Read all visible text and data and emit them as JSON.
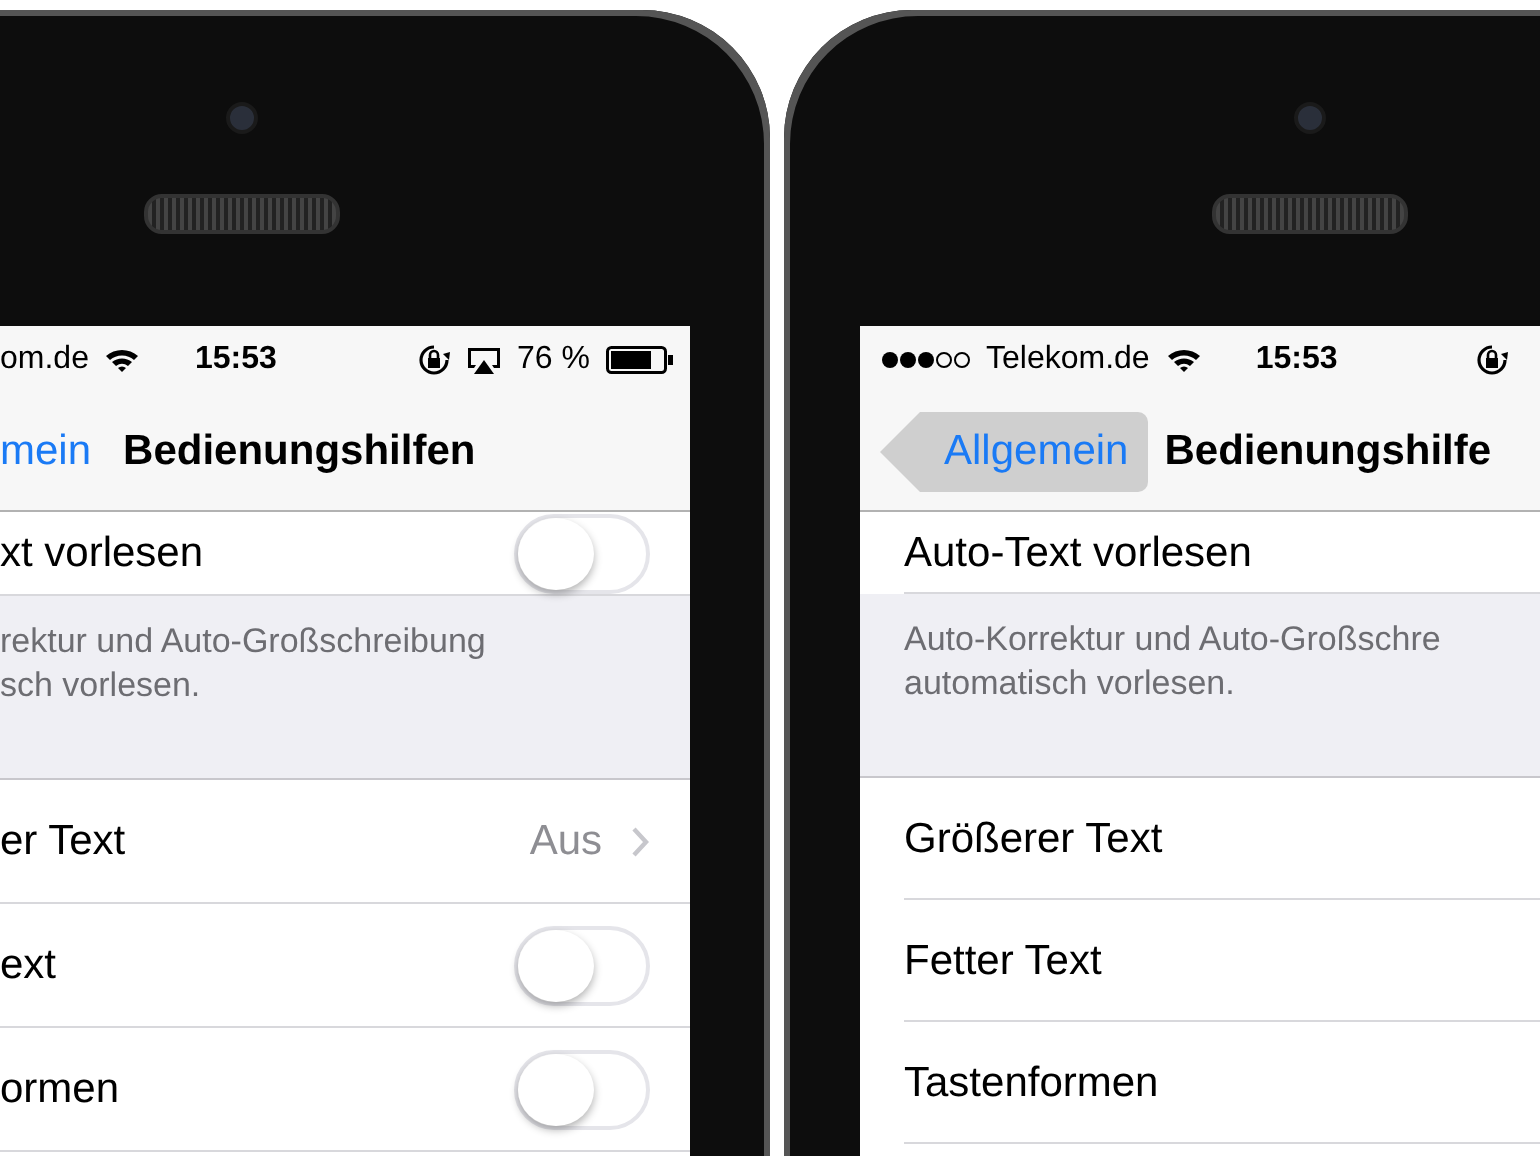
{
  "phones": [
    {
      "status_bar": [
        {
          "kind": "carrier",
          "text": "om.de"
        },
        {
          "kind": "wifi"
        },
        {
          "kind": "time",
          "text": "15:53"
        },
        {
          "kind": "rotation-lock"
        },
        {
          "kind": "airplay"
        },
        {
          "kind": "battery-text",
          "text": "76 %"
        },
        {
          "kind": "battery"
        }
      ],
      "nav": {
        "back": {
          "label": "mein",
          "pressed": false
        },
        "title": "Bedienungshilfen"
      },
      "groups": [
        {
          "rows": [
            {
              "label": "xt vorlesen",
              "kind": "toggle",
              "on": false
            }
          ],
          "footer": [
            "rektur und Auto-Großschreibung",
            "sch vorlesen."
          ]
        },
        {
          "rows": [
            {
              "label": "er Text",
              "kind": "disclosure",
              "value": "Aus"
            },
            {
              "label": "ext",
              "kind": "toggle",
              "on": false
            },
            {
              "label": "ormen",
              "kind": "toggle",
              "on": false
            }
          ]
        }
      ]
    },
    {
      "status_bar": [
        {
          "kind": "signal"
        },
        {
          "kind": "carrier",
          "text": "Telekom.de"
        },
        {
          "kind": "wifi"
        },
        {
          "kind": "time",
          "text": "15:53"
        },
        {
          "kind": "rotation-lock"
        }
      ],
      "nav": {
        "back": {
          "label": "Allgemein",
          "pressed": true
        },
        "title": "Bedienungshilfe"
      },
      "groups": [
        {
          "rows": [
            {
              "label": "Auto-Text vorlesen",
              "kind": "plain"
            }
          ],
          "footer": [
            "Auto-Korrektur und Auto-Großschre",
            "automatisch vorlesen."
          ]
        },
        {
          "rows": [
            {
              "label": "Größerer Text",
              "kind": "plain"
            },
            {
              "label": "Fetter Text",
              "kind": "plain"
            },
            {
              "label": "Tastenformen",
              "kind": "plain"
            }
          ]
        }
      ]
    }
  ]
}
